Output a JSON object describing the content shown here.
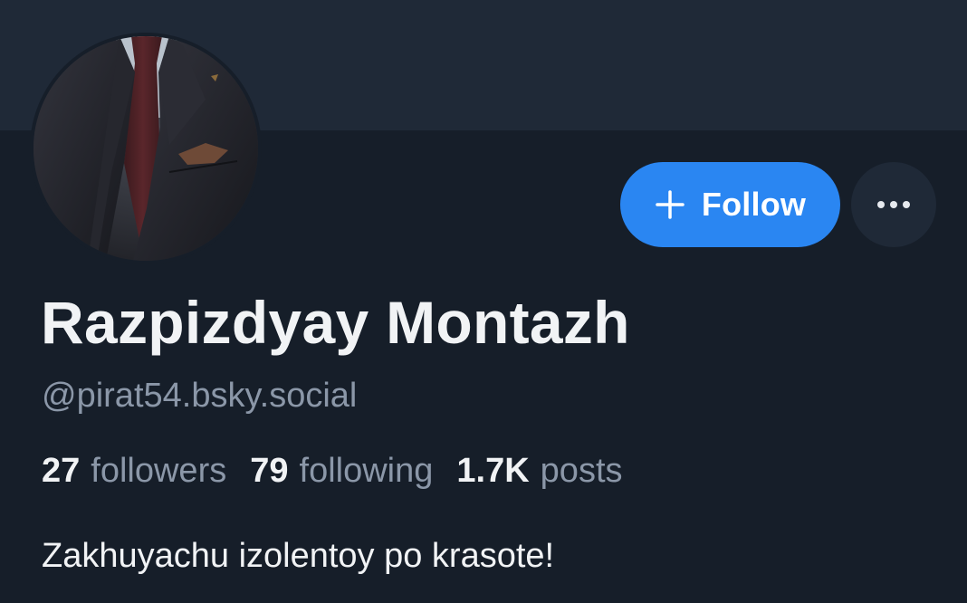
{
  "profile": {
    "display_name": "Razpizdyay Montazh",
    "handle": "@pirat54.bsky.social",
    "bio": "Zakhuyachu izolentoy po krasote!",
    "avatar_icon": "avatar-suit-photo"
  },
  "actions": {
    "follow_label": "Follow",
    "follow_icon": "plus-icon",
    "more_icon": "ellipsis-icon"
  },
  "stats": {
    "followers_count": "27",
    "followers_label": "followers",
    "following_count": "79",
    "following_label": "following",
    "posts_count": "1.7K",
    "posts_label": "posts"
  },
  "colors": {
    "background": "#161e29",
    "banner": "#1f2937",
    "accent": "#2a86f2",
    "text_primary": "#f1f3f5",
    "text_secondary": "#8b97a8"
  }
}
